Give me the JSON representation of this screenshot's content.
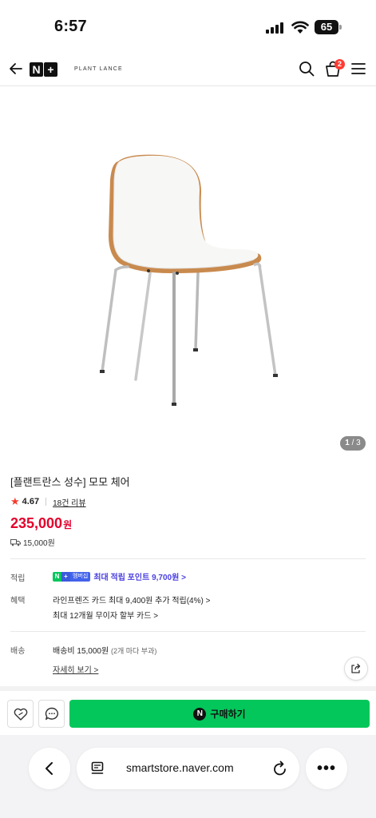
{
  "status_bar": {
    "time": "6:57",
    "battery": "65"
  },
  "header": {
    "logo": "N+",
    "brand": "PLANT LANCE",
    "cart_count": "2",
    "icons": [
      "back-arrow-icon",
      "search-icon",
      "cart-icon",
      "menu-icon"
    ]
  },
  "gallery": {
    "current": "1",
    "separator": " / ",
    "total": "3"
  },
  "product": {
    "title": "[플랜트란스 성수] 모모 체어",
    "rating": "4.67",
    "reviews": "18건 리뷰",
    "price": "235,000",
    "price_unit": "원",
    "shipping_fee": "15,000원"
  },
  "benefits": {
    "points_label": "적립",
    "membership_badge": "멤버십",
    "points_text": "최대 적립 포인트 9,700원 >",
    "benefit_label": "혜택",
    "benefit_line1": "라인프렌즈 카드 최대 9,400원 추가 적립(4%) >",
    "benefit_line2": "최대 12개월 무이자 할부 카드 >",
    "delivery_label": "배송",
    "delivery_fee": "배송비 15,000원",
    "delivery_note": "(2개 마다 부과)",
    "details_link": "자세히 보기 >"
  },
  "actions": {
    "buy_label": "구매하기"
  },
  "browser": {
    "url": "smartstore.naver.com"
  },
  "colors": {
    "accent_green": "#03c75a",
    "price_red": "#e3002d",
    "points_purple": "#4a3fe0",
    "star": "#f33b2d"
  }
}
